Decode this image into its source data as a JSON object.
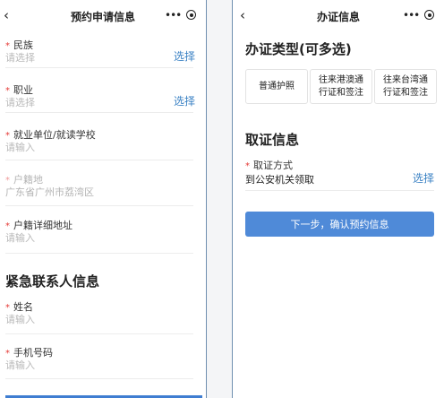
{
  "left": {
    "title": "预约申请信息",
    "more_glyph": "•••",
    "fields": {
      "ethnicity": {
        "star": "*",
        "label": "民族",
        "placeholder": "请选择",
        "action": "选择"
      },
      "occupation": {
        "star": "*",
        "label": "职业",
        "placeholder": "请选择",
        "action": "选择"
      },
      "employer": {
        "star": "*",
        "label": "就业单位/就读学校",
        "placeholder": "请输入"
      },
      "hukou": {
        "star": "*",
        "label": "户籍地",
        "value": "广东省广州市荔湾区"
      },
      "hukou_address": {
        "star": "*",
        "label": "户籍详细地址",
        "placeholder": "请输入"
      }
    },
    "emergency": {
      "section_title": "紧急联系人信息",
      "name": {
        "star": "*",
        "label": "姓名",
        "placeholder": "请输入"
      },
      "phone": {
        "star": "*",
        "label": "手机号码",
        "placeholder": "请输入"
      }
    }
  },
  "right": {
    "title": "办证信息",
    "more_glyph": "•••",
    "type_section_title": "办证类型(可多选)",
    "types": [
      {
        "line1": "普通护照",
        "line2": ""
      },
      {
        "line1": "往来港澳通",
        "line2": "行证和签注"
      },
      {
        "line1": "往来台湾通",
        "line2": "行证和签注"
      }
    ],
    "pickup_section_title": "取证信息",
    "pickup": {
      "star": "*",
      "label": "取证方式",
      "value": "到公安机关领取",
      "action": "选择"
    },
    "next_button": "下一步，确认预约信息"
  },
  "colors": {
    "accent": "#3b82c4",
    "primary_button": "#4f8ad8",
    "required_star": "#e53935",
    "placeholder": "#b9b9b9"
  }
}
